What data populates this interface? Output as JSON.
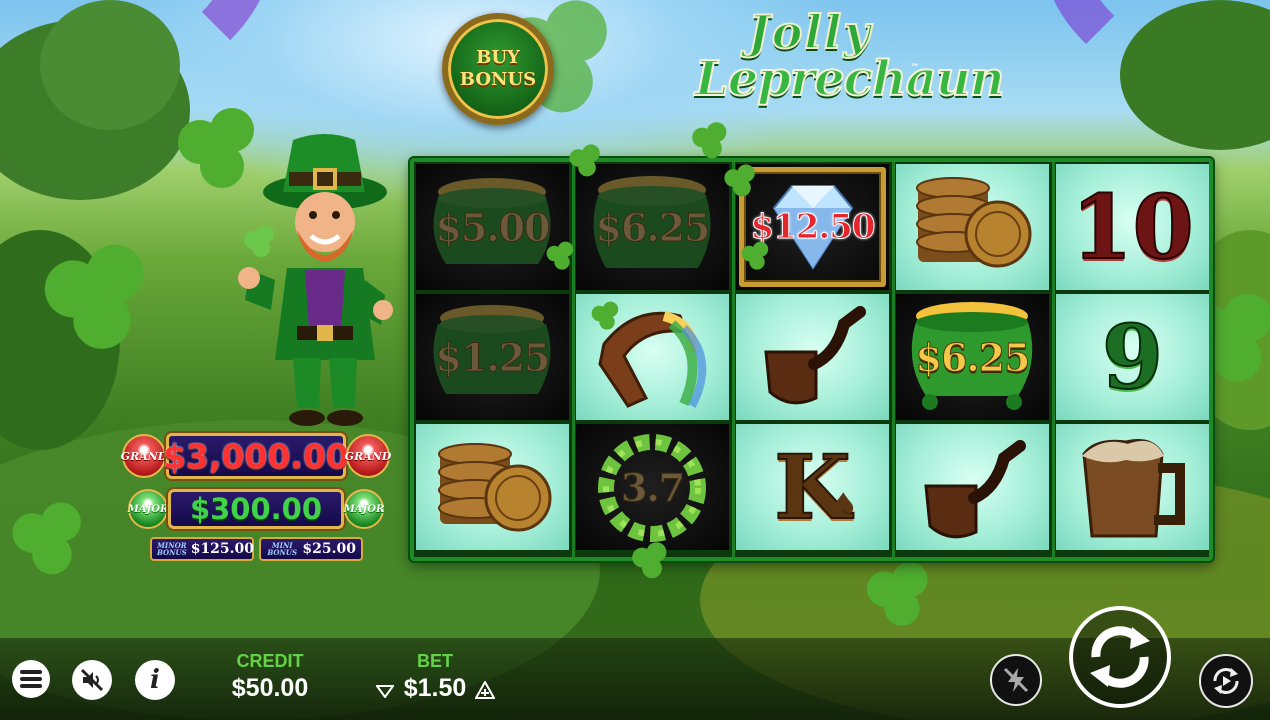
{
  "game": {
    "logo_line1": "Jolly",
    "logo_line2": "Leprechaun",
    "trademark": "™"
  },
  "buy_bonus": {
    "line1": "BUY",
    "line2": "BONUS"
  },
  "jackpots": {
    "grand": {
      "label": "GRAND",
      "amount": "$3,000.00"
    },
    "major": {
      "label": "MAJOR",
      "amount": "$300.00"
    },
    "minor": {
      "label": "MINOR BONUS",
      "amount": "$125.00"
    },
    "mini": {
      "label": "MINI BONUS",
      "amount": "$25.00"
    }
  },
  "reels": {
    "columns": [
      [
        {
          "symbol": "pot-of-gold",
          "value": "$5.00"
        },
        {
          "symbol": "pot-of-gold",
          "value": "$1.25"
        },
        {
          "symbol": "gold-coins",
          "value": ""
        }
      ],
      [
        {
          "symbol": "pot-of-gold",
          "value": "$6.25"
        },
        {
          "symbol": "horseshoe",
          "value": ""
        },
        {
          "symbol": "clover-wreath",
          "value": "3.7"
        }
      ],
      [
        {
          "symbol": "diamond",
          "value": "$12.50"
        },
        {
          "symbol": "pipe",
          "value": ""
        },
        {
          "symbol": "card-king",
          "value": "K"
        }
      ],
      [
        {
          "symbol": "gold-coins",
          "value": ""
        },
        {
          "symbol": "pot-of-gold",
          "value": "$6.25"
        },
        {
          "symbol": "pipe",
          "value": ""
        }
      ],
      [
        {
          "symbol": "card-ten",
          "value": "10"
        },
        {
          "symbol": "card-nine",
          "value": "9"
        },
        {
          "symbol": "beer-mug",
          "value": ""
        }
      ]
    ]
  },
  "bottom_bar": {
    "credit_label": "CREDIT",
    "credit_value": "$50.00",
    "bet_label": "BET",
    "bet_value": "$1.50",
    "icons": [
      "menu-icon",
      "sound-off-icon",
      "info-icon",
      "turbo-off-icon",
      "spin-icon",
      "autoplay-icon"
    ]
  },
  "colors": {
    "label_green": "#63d247",
    "reel_frame_green": "#1f8a26",
    "jackpot_red": "#ff3030",
    "jackpot_green": "#41d14a",
    "gold": "#c99534"
  }
}
